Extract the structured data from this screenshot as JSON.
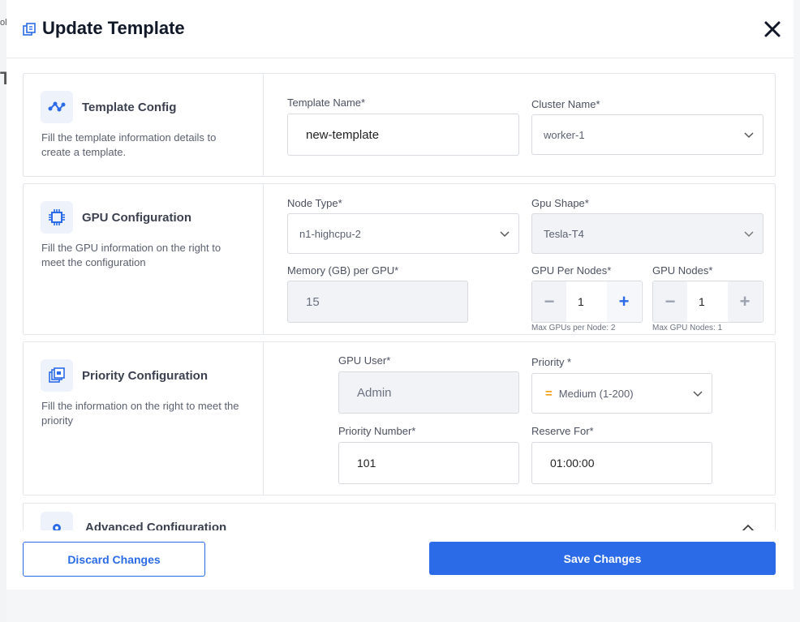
{
  "modal": {
    "title": "Update Template",
    "close_icon": "close-icon"
  },
  "template_config": {
    "title": "Template Config",
    "description": "Fill the template information details to create a template.",
    "template_name_label": "Template Name*",
    "template_name_value": "new-template",
    "cluster_name_label": "Cluster Name*",
    "cluster_name_value": "worker-1"
  },
  "gpu_config": {
    "title": "GPU Configuration",
    "description": "Fill the GPU information on the right to meet the configuration",
    "node_type_label": "Node Type*",
    "node_type_value": "n1-highcpu-2",
    "gpu_shape_label": "Gpu Shape*",
    "gpu_shape_value": "Tesla-T4",
    "memory_label": "Memory (GB) per GPU*",
    "memory_value": "15",
    "gpu_per_nodes_label": "GPU Per Nodes*",
    "gpu_per_nodes_value": "1",
    "gpu_per_nodes_hint": "Max GPUs per Node: 2",
    "gpu_nodes_label": "GPU Nodes*",
    "gpu_nodes_value": "1",
    "gpu_nodes_hint": "Max GPU Nodes: 1"
  },
  "priority_config": {
    "title": "Priority Configuration",
    "description": "Fill the information on the right to meet the priority",
    "gpu_user_label": "GPU User*",
    "gpu_user_value": "Admin",
    "priority_label": "Priority *",
    "priority_value": "Medium (1-200)",
    "priority_mark": "=",
    "priority_number_label": "Priority Number*",
    "priority_number_value": "101",
    "reserve_for_label": "Reserve For*",
    "reserve_for_value": "01:00:00"
  },
  "advanced_config": {
    "title": "Advanced Configuration"
  },
  "footer": {
    "discard_label": "Discard Changes",
    "save_label": "Save Changes"
  },
  "colors": {
    "accent": "#2b6be8",
    "priority_medium": "#f59e0b"
  }
}
